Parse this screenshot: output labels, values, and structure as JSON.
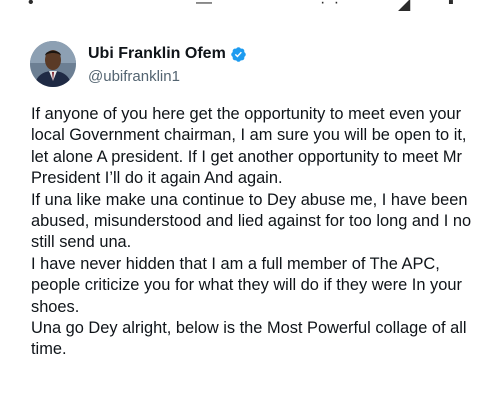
{
  "tweet": {
    "author": {
      "display_name": "Ubi Franklin Ofem",
      "handle": "@ubifranklin1",
      "verified": true,
      "verified_color": "#1d9bf0"
    },
    "paragraphs": [
      "If anyone of you here get the opportunity to meet even your local Government chairman, I am sure you will be open to it, let alone A president. If I get another opportunity to meet Mr President I’ll do it again And again.",
      "If una like make una continue to Dey abuse me, I have been abused, misunderstood and lied against for too long and I no still send una.",
      "I have never hidden that I am a full member of The APC, people criticize you for what they will do if they were In your shoes.",
      "Una go Dey alright, below is the Most Powerful collage of all time."
    ]
  },
  "icons": {
    "avatar": "profile-photo",
    "verified": "verified-badge-icon"
  },
  "colors": {
    "text": "#0f1419",
    "handle": "#536471",
    "background": "#ffffff"
  }
}
